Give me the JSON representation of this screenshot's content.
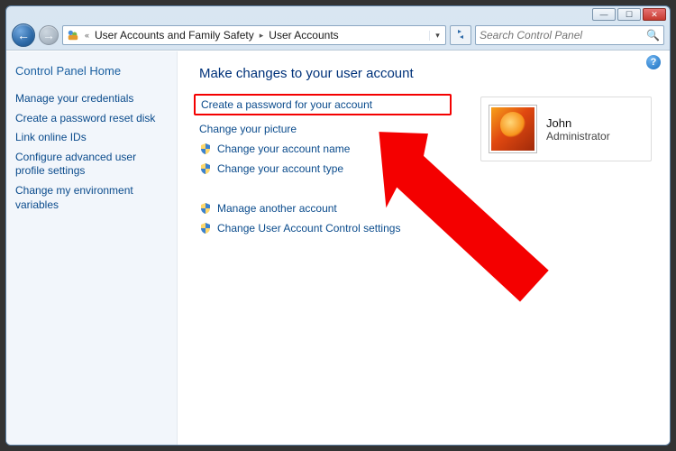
{
  "titlebar": {
    "minimize": "—",
    "maximize": "☐",
    "close": "✕"
  },
  "nav": {
    "back_glyph": "←",
    "fwd_glyph": "→",
    "refresh_glyph": "↻"
  },
  "breadcrumb": {
    "double_chev": "«",
    "seg1": "User Accounts and Family Safety",
    "seg2": "User Accounts",
    "chev": "▸",
    "drop": "▾"
  },
  "search": {
    "placeholder": "Search Control Panel",
    "mag": "🔍"
  },
  "sidebar": {
    "heading": "Control Panel Home",
    "links": [
      "Manage your credentials",
      "Create a password reset disk",
      "Link online IDs",
      "Configure advanced user profile settings",
      "Change my environment variables"
    ]
  },
  "main": {
    "heading": "Make changes to your user account",
    "tasks": {
      "create_password": "Create a password for your account",
      "change_picture": "Change your picture",
      "change_name": "Change your account name",
      "change_type": "Change your account type",
      "manage_another": "Manage another account",
      "uac_settings": "Change User Account Control settings"
    }
  },
  "user": {
    "name": "John",
    "type": "Administrator"
  },
  "help": {
    "glyph": "?"
  }
}
